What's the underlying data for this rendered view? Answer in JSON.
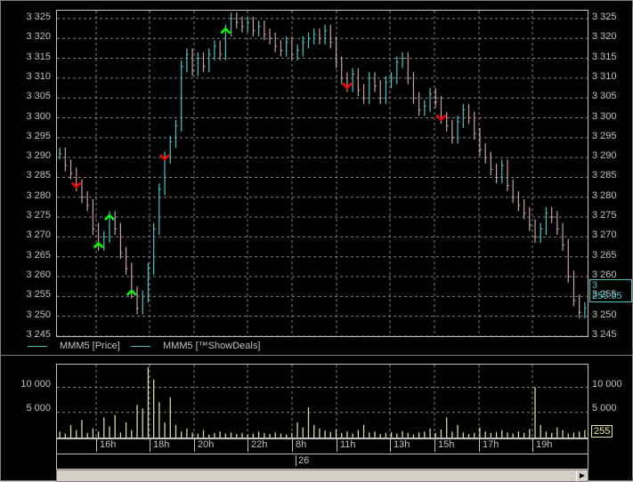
{
  "main_chart": {
    "y_labels": [
      "3 325",
      "3 320",
      "3 315",
      "3 310",
      "3 305",
      "3 300",
      "3 295",
      "3 290",
      "3 285",
      "3 280",
      "3 275",
      "3 270",
      "3 265",
      "3 260",
      "3 255",
      "3 250",
      "3 245"
    ],
    "y_values": [
      3325,
      3320,
      3315,
      3310,
      3305,
      3300,
      3295,
      3290,
      3285,
      3280,
      3275,
      3270,
      3265,
      3260,
      3255,
      3250,
      3245
    ],
    "current_price": "3 255.55",
    "legend": [
      {
        "label": "MMM5 [Price]",
        "color": "#4fc3c3"
      },
      {
        "label": "MMM5 [™ShowDeals]",
        "color": "#4fc3c3"
      }
    ]
  },
  "volume_chart": {
    "y_labels": [
      "10 000",
      "5 000"
    ],
    "current_value": "255"
  },
  "time_axis": {
    "hour_labels": [
      "16h",
      "18h",
      "20h",
      "22h",
      "8h",
      "11h",
      "13h",
      "15h",
      "17h",
      "19h"
    ],
    "day_label": "26"
  },
  "chart_data": {
    "type": "bar",
    "title": "",
    "ylim": [
      3245,
      3327
    ],
    "colors": {
      "up": "#4fc3c3",
      "down": "#c8a0a0",
      "buy": "#00ff00",
      "sell": "#ff0000",
      "volume": "#d8d8a0"
    },
    "price_close": [
      3291,
      3288,
      3286,
      3283,
      3280,
      3278,
      3272,
      3268,
      3270,
      3275,
      3272,
      3266,
      3262,
      3256,
      3252,
      3255,
      3262,
      3272,
      3282,
      3290,
      3294,
      3298,
      3313,
      3316,
      3312,
      3315,
      3313,
      3316,
      3318,
      3316,
      3322,
      3325,
      3324,
      3323,
      3324,
      3322,
      3323,
      3321,
      3320,
      3318,
      3317,
      3319,
      3316,
      3317,
      3319,
      3320,
      3321,
      3320,
      3322,
      3319,
      3314,
      3310,
      3308,
      3311,
      3307,
      3305,
      3310,
      3308,
      3305,
      3309,
      3310,
      3314,
      3315,
      3310,
      3305,
      3302,
      3303,
      3306,
      3304,
      3300,
      3298,
      3295,
      3299,
      3302,
      3300,
      3296,
      3292,
      3290,
      3287,
      3285,
      3288,
      3283,
      3280,
      3278,
      3276,
      3273,
      3270,
      3272,
      3276,
      3275,
      3272,
      3268,
      3260,
      3254,
      3251,
      3252
    ],
    "volumes": [
      1200,
      800,
      2500,
      1500,
      3500,
      900,
      1800,
      1200,
      4000,
      2200,
      4500,
      1000,
      3000,
      1500,
      6500,
      5800,
      14000,
      11500,
      7000,
      3000,
      8000,
      2500,
      1200,
      1800,
      1000,
      800,
      1500,
      600,
      900,
      1200,
      800,
      1000,
      700,
      900,
      600,
      800,
      1200,
      900,
      700,
      1000,
      800,
      600,
      900,
      3000,
      2000,
      6000,
      2500,
      1800,
      1400,
      1100,
      1600,
      900,
      1200,
      800,
      1500,
      2500,
      1000,
      1200,
      700,
      900,
      1100,
      800,
      1300,
      900,
      600,
      1000,
      1200,
      1800,
      900,
      1600,
      4000,
      1200,
      2500,
      1000,
      700,
      900,
      2000,
      1200,
      900,
      1100,
      1500,
      1000,
      800,
      1200,
      900,
      1700,
      10000,
      2500,
      1200,
      900,
      2000,
      1500,
      800,
      1000,
      1200,
      1500
    ],
    "sell_signals": [
      3283,
      3290,
      3308,
      3300
    ],
    "buy_signals": [
      3256,
      3268,
      3322,
      3275
    ]
  }
}
